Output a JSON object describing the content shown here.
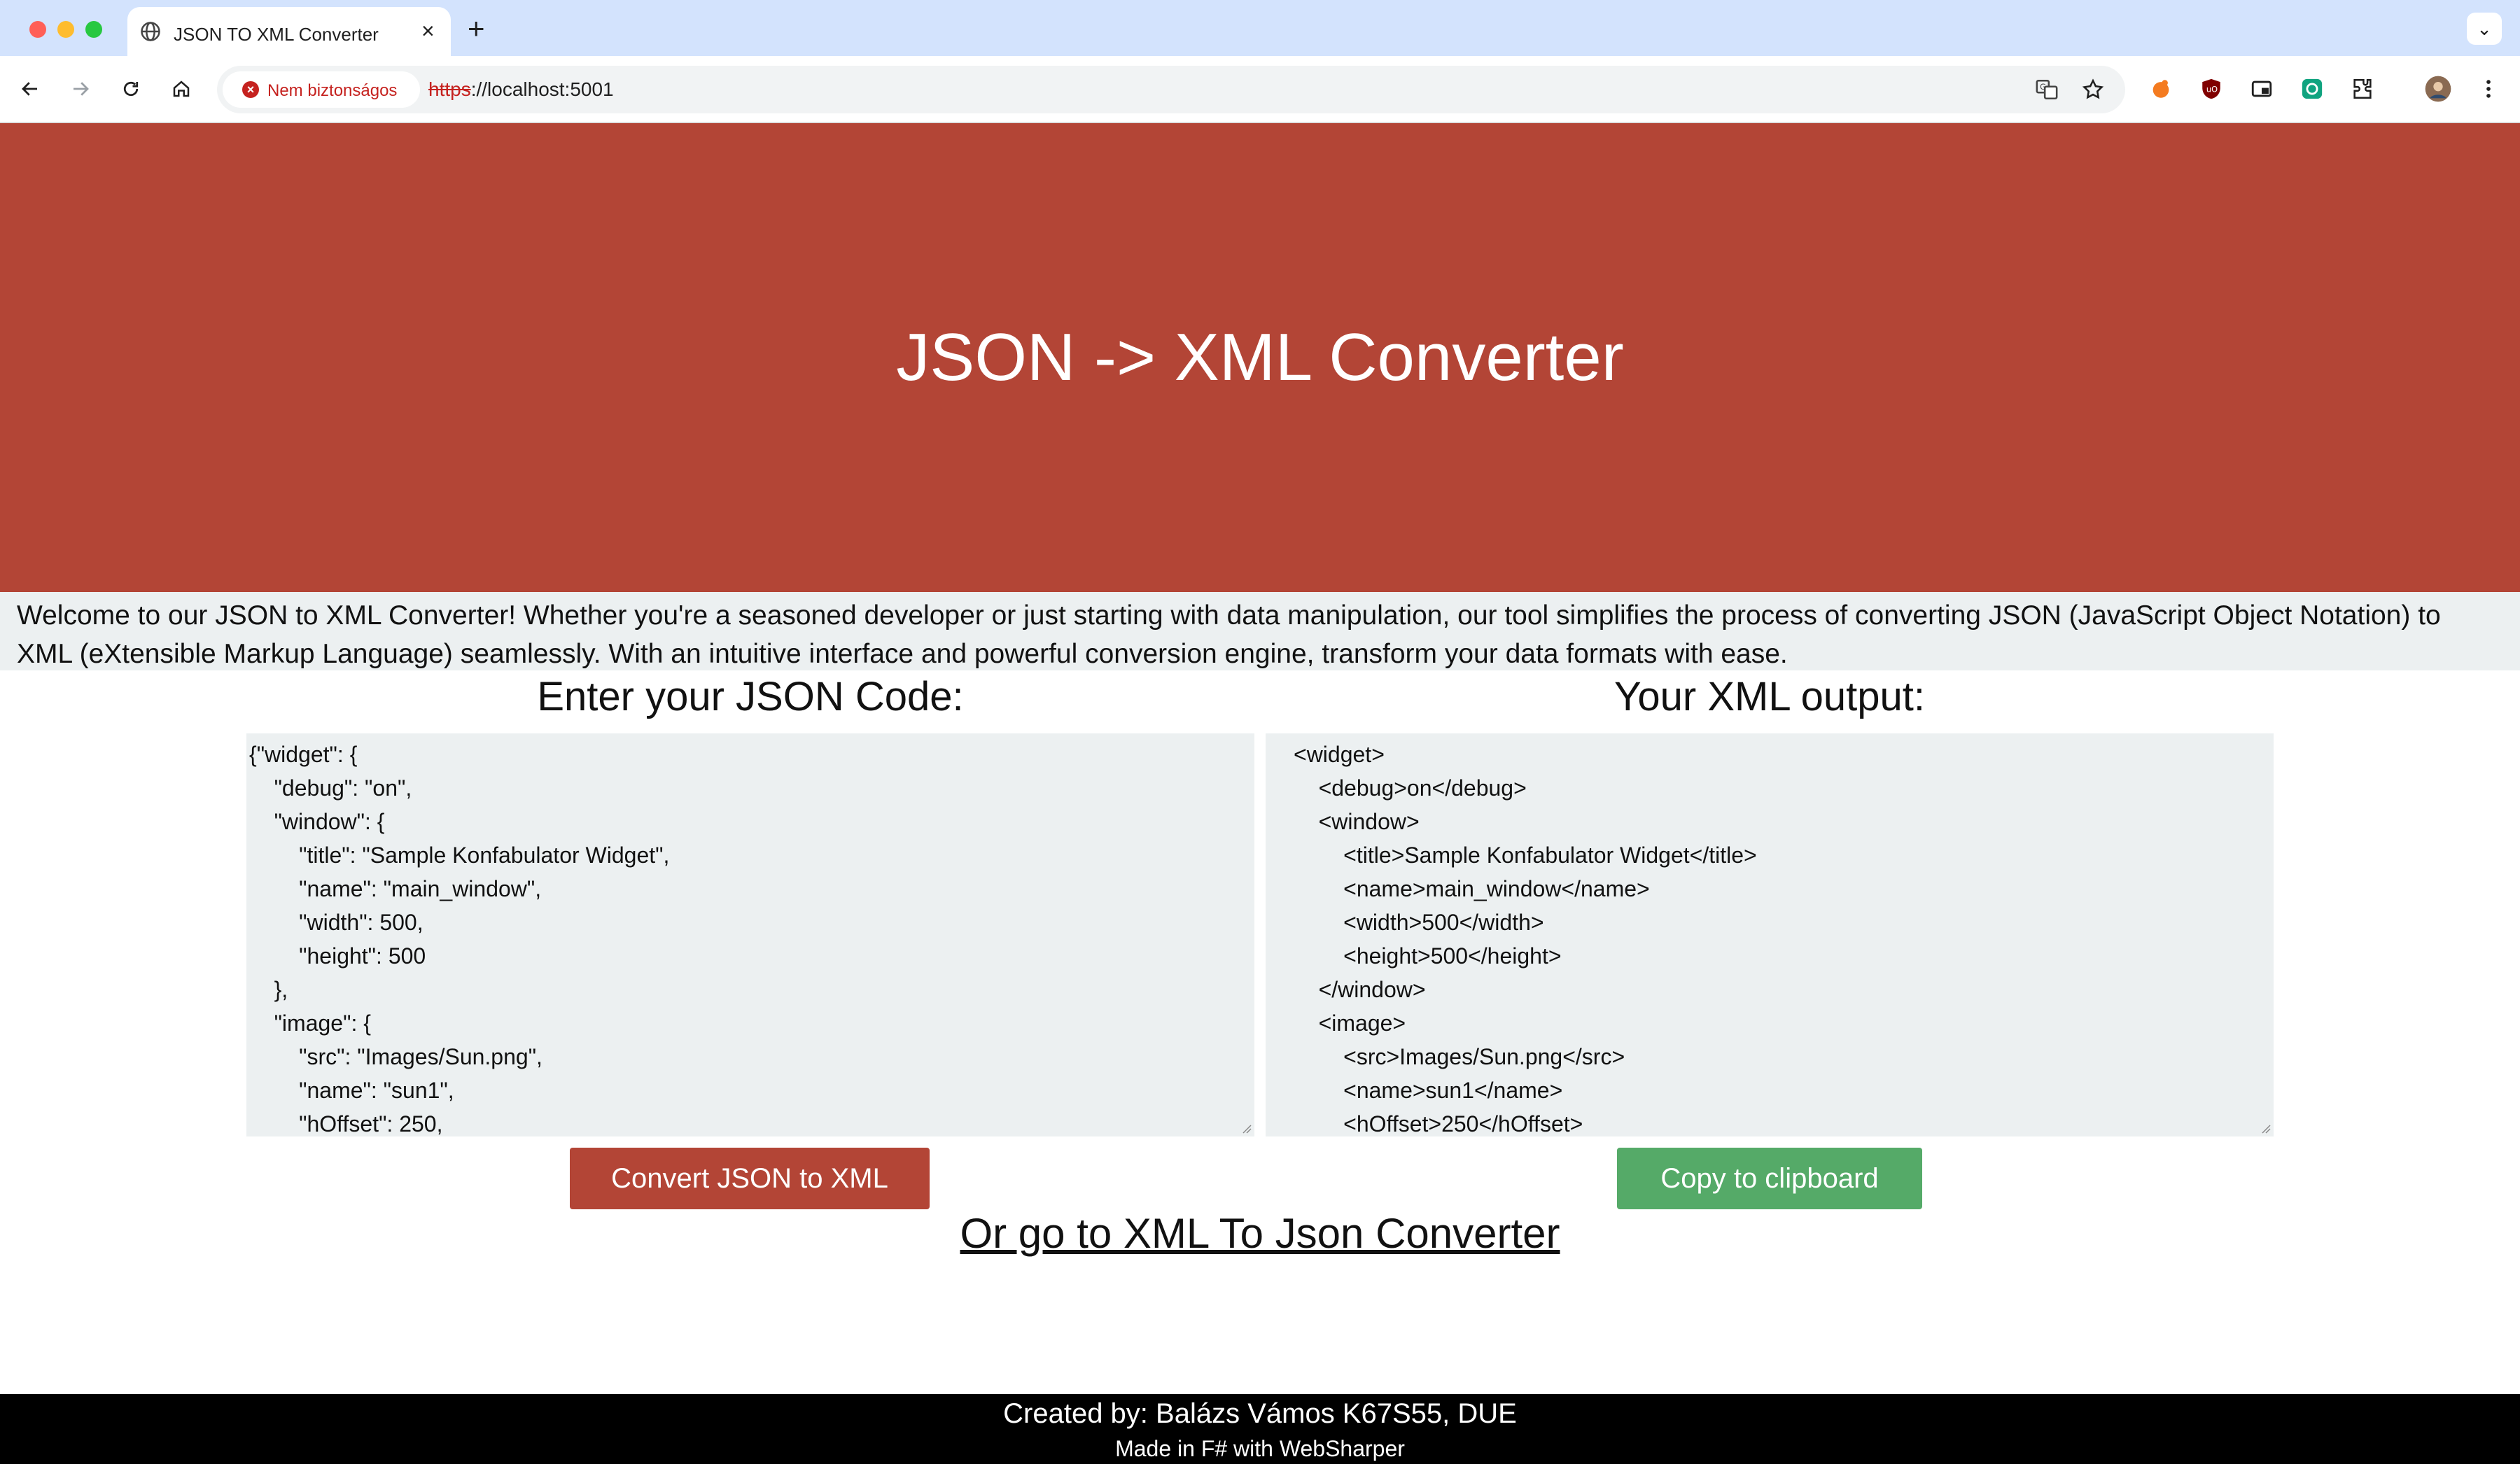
{
  "browser": {
    "tab_title": "JSON TO XML Converter",
    "security_label": "Nem biztonságos",
    "url_scheme": "https",
    "url_rest": "://localhost:5001"
  },
  "hero": {
    "title": "JSON -> XML Converter"
  },
  "intro": {
    "text": "Welcome to our JSON to XML Converter! Whether you're a seasoned developer or just starting with data manipulation, our tool simplifies the process of converting JSON (JavaScript Object Notation) to XML (eXtensible Markup Language) seamlessly. With an intuitive interface and powerful conversion engine, transform your data formats with ease."
  },
  "input_panel": {
    "heading": "Enter your JSON Code:",
    "value": "{\"widget\": {\n    \"debug\": \"on\",\n    \"window\": {\n        \"title\": \"Sample Konfabulator Widget\",\n        \"name\": \"main_window\",\n        \"width\": 500,\n        \"height\": 500\n    },\n    \"image\": {\n        \"src\": \"Images/Sun.png\",\n        \"name\": \"sun1\",\n        \"hOffset\": 250,"
  },
  "output_panel": {
    "heading": "Your XML output:",
    "value": "<widget>\n    <debug>on</debug>\n    <window>\n        <title>Sample Konfabulator Widget</title>\n        <name>main_window</name>\n        <width>500</width>\n        <height>500</height>\n    </window>\n    <image>\n        <src>Images/Sun.png</src>\n        <name>sun1</name>\n        <hOffset>250</hOffset>"
  },
  "buttons": {
    "convert_label": "Convert JSON to XML",
    "copy_label": "Copy to clipboard"
  },
  "links": {
    "goto_label": "Or go to XML To Json Converter"
  },
  "footer": {
    "created_by": "Created by: Balázs Vámos K67S55, DUE",
    "made_with": "Made in F# with WebSharper"
  },
  "colors": {
    "hero_bg": "#b34536",
    "intro_bg": "#ecf0f1",
    "copy_button": "#55aa68",
    "footer_bg": "#000000"
  }
}
